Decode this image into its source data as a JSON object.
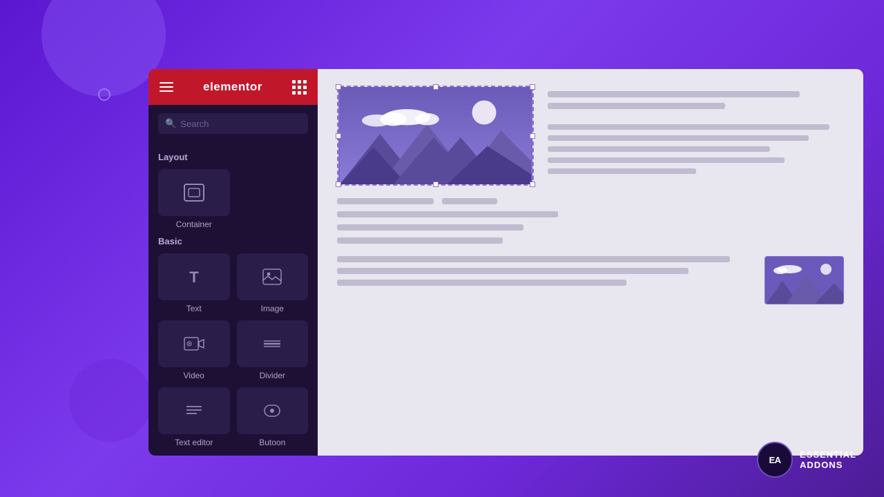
{
  "background": {
    "color": "#6B21E8"
  },
  "sidebar": {
    "title": "elementor",
    "search_placeholder": "Search",
    "sections": [
      {
        "label": "Layout",
        "widgets": [
          {
            "id": "container",
            "label": "Container",
            "icon": "▦"
          }
        ]
      },
      {
        "label": "Basic",
        "widgets": [
          {
            "id": "text",
            "label": "Text",
            "icon": "T"
          },
          {
            "id": "image",
            "label": "Image",
            "icon": "🖼"
          },
          {
            "id": "video",
            "label": "Video",
            "icon": "▶"
          },
          {
            "id": "divider",
            "label": "Divider",
            "icon": "≡"
          },
          {
            "id": "text-editor",
            "label": "Text editor",
            "icon": "≡"
          },
          {
            "id": "button",
            "label": "Butoon",
            "icon": "☎"
          }
        ]
      }
    ]
  },
  "ea_badge": {
    "logo_text": "EA",
    "line1": "ESSENTIAL",
    "line2": "ADDONS"
  }
}
